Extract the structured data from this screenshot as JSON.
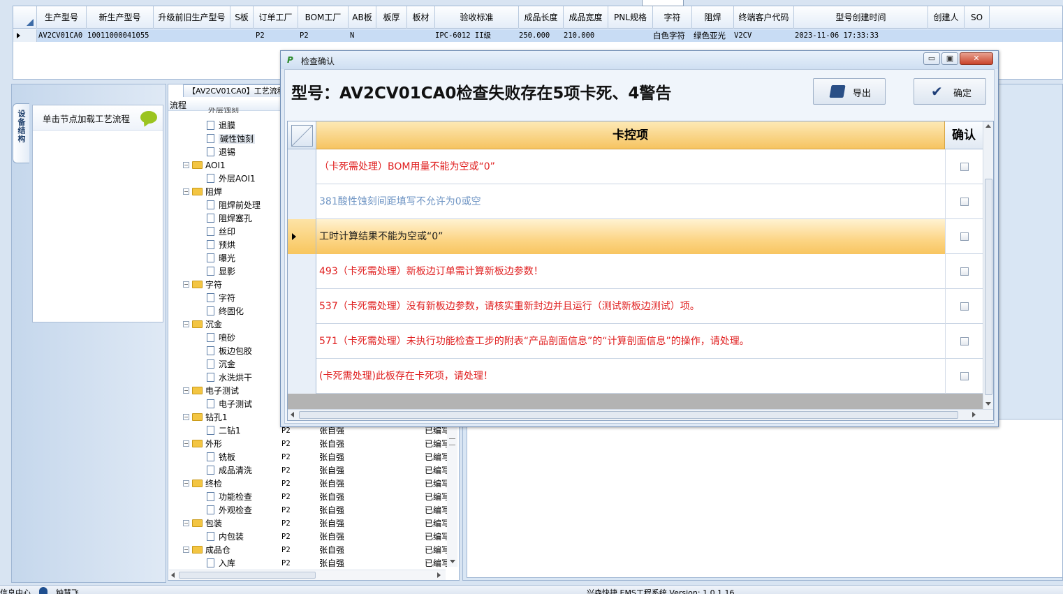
{
  "top_grid": {
    "headers": [
      "生产型号",
      "新生产型号",
      "升级前旧生产型号",
      "S板",
      "订单工厂",
      "BOM工厂",
      "AB板",
      "板厚",
      "板材",
      "验收标准",
      "成品长度",
      "成品宽度",
      "PNL规格",
      "字符",
      "阻焊",
      "终端客户代码",
      "型号创建时间",
      "创建人",
      "SO"
    ],
    "row": {
      "model": "AV2CV01CA0",
      "new_model": "10011000041055",
      "order_factory": "P2",
      "bom_factory": "P2",
      "ab_board": "N",
      "standard": "IPC-6012 II级",
      "length": "250.000",
      "width": "210.000",
      "char": "白色字符",
      "solder": "绿色亚光",
      "customer": "V2CV",
      "created": "2023-11-06 17:33:33"
    }
  },
  "left_panel": {
    "side_tab": "设备结构",
    "hint": "单击节点加载工艺流程"
  },
  "tree": {
    "tab_title": "【AV2CV01CA0】工艺流程",
    "column_header": "流程",
    "top_partial": "外层蚀刻",
    "nodes": [
      {
        "type": "doc",
        "label": "退膜"
      },
      {
        "type": "doc",
        "label": "碱性蚀刻",
        "selected": true
      },
      {
        "type": "doc",
        "label": "退锡"
      },
      {
        "type": "folder",
        "label": "AOI1"
      },
      {
        "type": "doc",
        "label": "外层AOI1"
      },
      {
        "type": "folder",
        "label": "阻焊"
      },
      {
        "type": "doc",
        "label": "阻焊前处理"
      },
      {
        "type": "doc",
        "label": "阻焊塞孔"
      },
      {
        "type": "doc",
        "label": "丝印"
      },
      {
        "type": "doc",
        "label": "预烘"
      },
      {
        "type": "doc",
        "label": "曝光"
      },
      {
        "type": "doc",
        "label": "显影"
      },
      {
        "type": "folder",
        "label": "字符"
      },
      {
        "type": "doc",
        "label": "字符"
      },
      {
        "type": "doc",
        "label": "终固化"
      },
      {
        "type": "folder",
        "label": "沉金"
      },
      {
        "type": "doc",
        "label": "喷砂"
      },
      {
        "type": "doc",
        "label": "板边包胶"
      },
      {
        "type": "doc",
        "label": "沉金"
      },
      {
        "type": "doc",
        "label": "水洗烘干"
      },
      {
        "type": "folder",
        "label": "电子测试"
      },
      {
        "type": "doc",
        "label": "电子测试"
      },
      {
        "type": "folder",
        "label": "钻孔1"
      },
      {
        "type": "doc",
        "label": "二钻1",
        "factory": "P2",
        "editor": "张自强",
        "status": "已编写"
      },
      {
        "type": "folder",
        "label": "外形",
        "factory": "P2",
        "editor": "张自强",
        "status": "已编写"
      },
      {
        "type": "doc",
        "label": "铣板",
        "factory": "P2",
        "editor": "张自强",
        "status": "已编写"
      },
      {
        "type": "doc",
        "label": "成品清洗",
        "factory": "P2",
        "editor": "张自强",
        "status": "已编写"
      },
      {
        "type": "folder",
        "label": "终检",
        "factory": "P2",
        "editor": "张自强",
        "status": "已编写"
      },
      {
        "type": "doc",
        "label": "功能检查",
        "factory": "P2",
        "editor": "张自强",
        "status": "已编写"
      },
      {
        "type": "doc",
        "label": "外观检查",
        "factory": "P2",
        "editor": "张自强",
        "status": "已编写"
      },
      {
        "type": "folder",
        "label": "包装",
        "factory": "P2",
        "editor": "张自强",
        "status": "已编写"
      },
      {
        "type": "doc",
        "label": "内包装",
        "factory": "P2",
        "editor": "张自强",
        "status": "已编写"
      },
      {
        "type": "folder",
        "label": "成品仓",
        "factory": "P2",
        "editor": "张自强",
        "status": "已编写"
      },
      {
        "type": "doc",
        "label": "入库",
        "factory": "P2",
        "editor": "张自强",
        "status": "已编写"
      }
    ]
  },
  "dialog": {
    "title": "检查确认",
    "title_icon": "P",
    "minimize_glyph": "▭",
    "maximize_glyph": "▣",
    "close_glyph": "✕",
    "headline": "型号：AV2CV01CA0检查失败存在5项卡死、4警告",
    "export_label": "导出",
    "confirm_label": "确定",
    "col_item": "卡控项",
    "col_confirm": "确认",
    "rows": [
      {
        "text": "（卡死需处理）BOM用量不能为空或“0”",
        "color": "#e02020"
      },
      {
        "text": "381酸性蚀刻间距填写不允许为0或空",
        "color": "#6f95c4"
      },
      {
        "text": "工时计算结果不能为空或“0”",
        "color": "#1a1a1a",
        "current": true
      },
      {
        "text": "493（卡死需处理）新板边订单需计算新板边参数！",
        "color": "#e02020"
      },
      {
        "text": "537（卡死需处理）没有新板边参数，请核实重新封边并且运行（测试新板边测试）项。",
        "color": "#e02020"
      },
      {
        "text": "571（卡死需处理）未执行功能检查工步的附表“产品剖面信息”的“计算剖面信息”的操作，请处理。",
        "color": "#e02020"
      },
      {
        "text": "(卡死需处理)此板存在卡死项，请处理！",
        "color": "#e02020"
      }
    ]
  },
  "status_bar": {
    "left": "信息中心",
    "user": "钟慧飞",
    "center": "兴森快捷 EMS工程系统 Version: 1.0.1.16"
  }
}
